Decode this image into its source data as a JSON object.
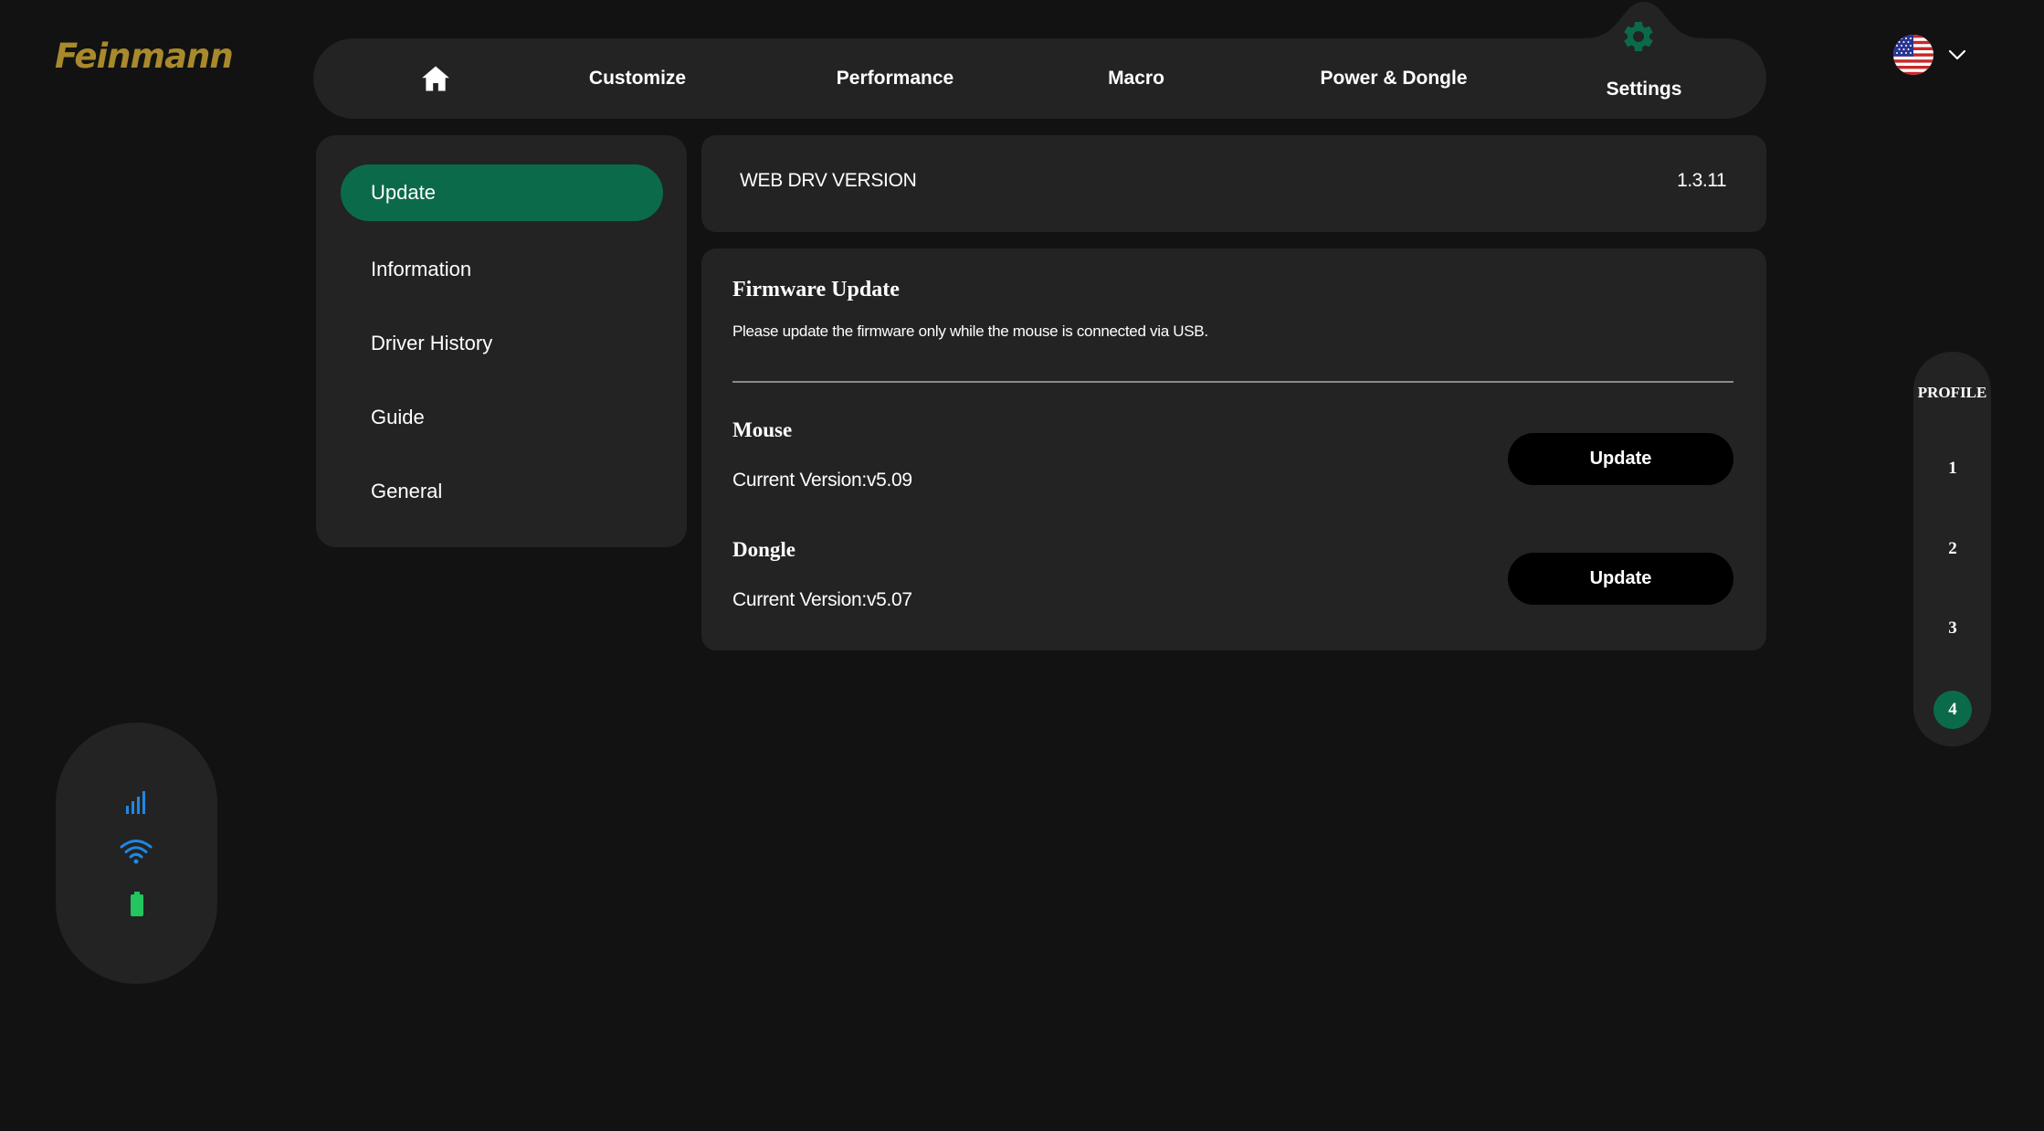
{
  "brand": {
    "logo_text": "Feinmann",
    "logo_color": "#a8892c"
  },
  "nav": {
    "home_icon": "home-icon",
    "items": [
      {
        "label": "Customize"
      },
      {
        "label": "Performance"
      },
      {
        "label": "Macro"
      },
      {
        "label": "Power & Dongle"
      },
      {
        "label": "Settings",
        "active": true,
        "icon": "gear-icon"
      }
    ]
  },
  "language": {
    "flag": "us-flag-icon",
    "dropdown_icon": "chevron-down-icon"
  },
  "settings_menu": {
    "items": [
      {
        "label": "Update",
        "active": true
      },
      {
        "label": "Information"
      },
      {
        "label": "Driver History"
      },
      {
        "label": "Guide"
      },
      {
        "label": "General"
      }
    ]
  },
  "web_drv": {
    "label": "WEB DRV VERSION",
    "value": "1.3.11"
  },
  "firmware": {
    "title": "Firmware Update",
    "description": "Please update the firmware only while the mouse is connected via USB.",
    "devices": [
      {
        "name": "Mouse",
        "version": "Current Version:v5.09",
        "button_label": "Update"
      },
      {
        "name": "Dongle",
        "version": "Current Version:v5.07",
        "button_label": "Update"
      }
    ]
  },
  "profile": {
    "label": "PROFILE",
    "items": [
      "1",
      "2",
      "3",
      "4"
    ],
    "active": "4"
  },
  "status": {
    "icons": [
      "signal-bars-icon",
      "wifi-icon",
      "battery-icon"
    ],
    "signal_color": "#1e88e5",
    "battery_color": "#22c55e"
  },
  "colors": {
    "accent": "#0b6a4a",
    "background": "#121212",
    "panel": "#232323"
  }
}
